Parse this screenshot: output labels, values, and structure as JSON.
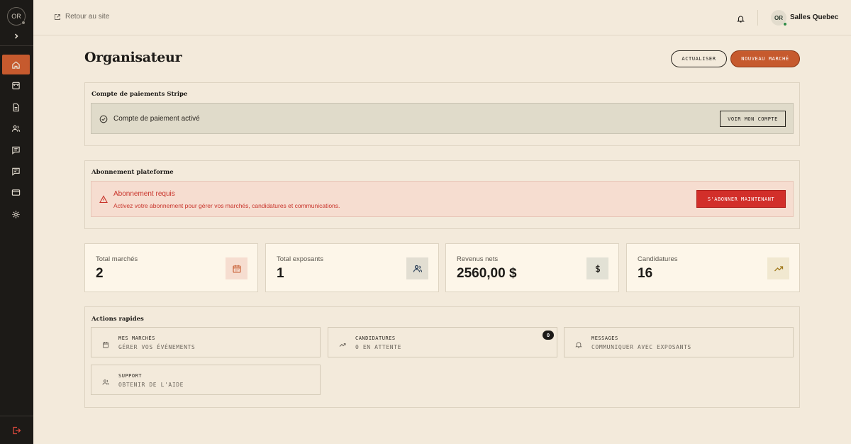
{
  "sidebar": {
    "avatar_initials": "OR",
    "items": [
      {
        "icon": "home-icon",
        "active": true
      },
      {
        "icon": "store-icon",
        "active": false
      },
      {
        "icon": "document-icon",
        "active": false
      },
      {
        "icon": "users-icon",
        "active": false
      },
      {
        "icon": "message-icon",
        "active": false
      },
      {
        "icon": "chat-icon",
        "active": false
      },
      {
        "icon": "credit-card-icon",
        "active": false
      },
      {
        "icon": "gear-icon",
        "active": false
      }
    ],
    "logout_icon": "logout-icon"
  },
  "topbar": {
    "back_link": "Retour au site",
    "user_initials": "OR",
    "user_name": "Salles Quebec"
  },
  "header": {
    "title": "Organisateur",
    "refresh_label": "ACTUALISER",
    "new_market_label": "NOUVEAU MARCHÉ"
  },
  "stripe": {
    "title": "Compte de paiements Stripe",
    "status": "Compte de paiement activé",
    "button": "VOIR MON COMPTE"
  },
  "subscription": {
    "title": "Abonnement plateforme",
    "warning_title": "Abonnement requis",
    "warning_text": "Activez votre abonnement pour gérer vos marchés, candidatures et communications.",
    "button": "S'ABONNER MAINTENANT"
  },
  "stats": [
    {
      "label": "Total marchés",
      "value": "2",
      "icon": "calendar-icon",
      "icon_bg": "#f6ddd0",
      "icon_color": "#c65a2e"
    },
    {
      "label": "Total exposants",
      "value": "1",
      "icon": "users-icon",
      "icon_bg": "#e2ded2",
      "icon_color": "#1f3550"
    },
    {
      "label": "Revenus nets",
      "value": "2560,00 $",
      "icon": "dollar-icon",
      "icon_bg": "#e2e1d5",
      "icon_color": "#1c1a17"
    },
    {
      "label": "Candidatures",
      "value": "16",
      "icon": "trending-up-icon",
      "icon_bg": "#f1e8d0",
      "icon_color": "#a0781a"
    }
  ],
  "quick_actions": {
    "title": "Actions rapides",
    "items": [
      {
        "title": "MES MARCHÉS",
        "subtitle": "GÉRER VOS ÉVÉNEMENTS",
        "icon": "calendar-icon"
      },
      {
        "title": "CANDIDATURES",
        "subtitle": "0 EN ATTENTE",
        "icon": "trending-up-icon",
        "badge": "0"
      },
      {
        "title": "MESSAGES",
        "subtitle": "COMMUNIQUER AVEC EXPOSANTS",
        "icon": "bell-icon"
      },
      {
        "title": "SUPPORT",
        "subtitle": "OBTENIR DE L'AIDE",
        "icon": "users-icon"
      }
    ]
  },
  "colors": {
    "accent": "#c65a2e",
    "danger": "#d22f2a",
    "background": "#f3eadb",
    "sidebar": "#1c1a17"
  }
}
